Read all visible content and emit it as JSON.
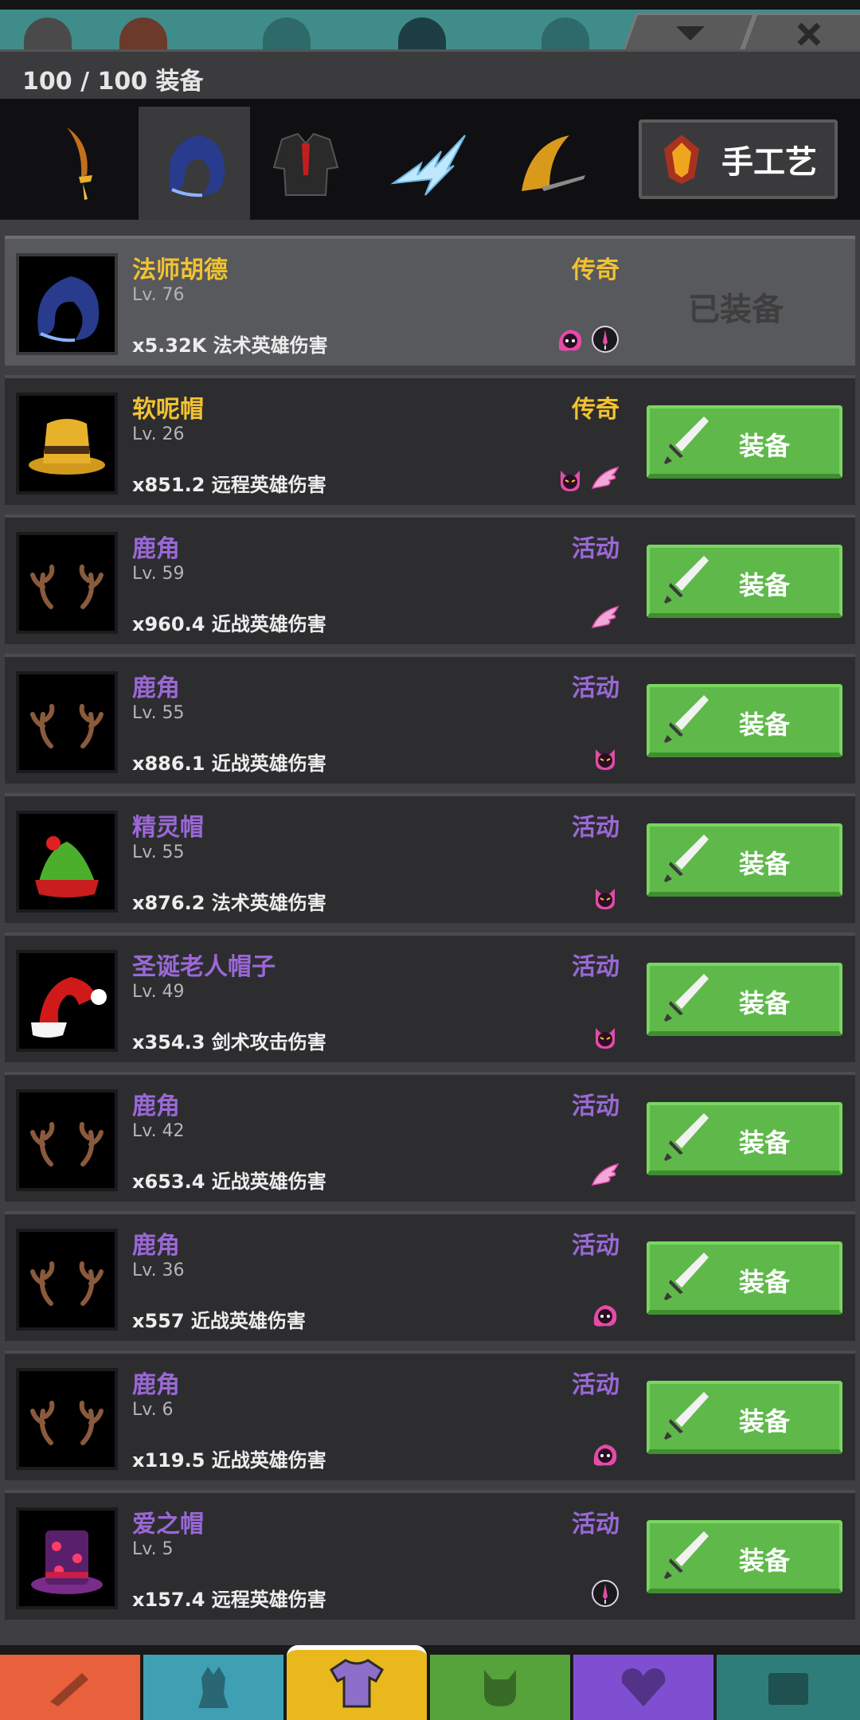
{
  "header": {
    "title": "100 / 100 装备"
  },
  "categories": [
    {
      "name": "weapon"
    },
    {
      "name": "helmet"
    },
    {
      "name": "armor"
    },
    {
      "name": "spell"
    },
    {
      "name": "relic"
    }
  ],
  "craft": {
    "label": "手工艺"
  },
  "colors": {
    "legendary": "#f2c230",
    "event": "#9a68d6",
    "equip_green": "#5fb94a"
  },
  "items": [
    {
      "name": "法师胡德",
      "rarity": "传奇",
      "level": "Lv. 76",
      "damage": "x5.32K 法术英雄伤害",
      "equipped": true,
      "equipped_label": "已装备",
      "icon": "wizard-hood-icon",
      "elements": [
        "shadow-icon",
        "dagger-icon"
      ]
    },
    {
      "name": "软呢帽",
      "rarity": "传奇",
      "level": "Lv. 26",
      "damage": "x851.2 远程英雄伤害",
      "equipped": false,
      "button_label": "装备",
      "icon": "fedora-icon",
      "elements": [
        "demon-icon",
        "wing-icon"
      ]
    },
    {
      "name": "鹿角",
      "rarity": "活动",
      "level": "Lv. 59",
      "damage": "x960.4 近战英雄伤害",
      "equipped": false,
      "button_label": "装备",
      "icon": "antlers-icon",
      "elements": [
        "wing-icon"
      ]
    },
    {
      "name": "鹿角",
      "rarity": "活动",
      "level": "Lv. 55",
      "damage": "x886.1 近战英雄伤害",
      "equipped": false,
      "button_label": "装备",
      "icon": "antlers-icon",
      "elements": [
        "demon-icon"
      ]
    },
    {
      "name": "精灵帽",
      "rarity": "活动",
      "level": "Lv. 55",
      "damage": "x876.2 法术英雄伤害",
      "equipped": false,
      "button_label": "装备",
      "icon": "elf-hat-icon",
      "elements": [
        "demon-icon"
      ]
    },
    {
      "name": "圣诞老人帽子",
      "rarity": "活动",
      "level": "Lv. 49",
      "damage": "x354.3 剑术攻击伤害",
      "equipped": false,
      "button_label": "装备",
      "icon": "santa-hat-icon",
      "elements": [
        "demon-icon"
      ]
    },
    {
      "name": "鹿角",
      "rarity": "活动",
      "level": "Lv. 42",
      "damage": "x653.4 近战英雄伤害",
      "equipped": false,
      "button_label": "装备",
      "icon": "antlers-icon",
      "elements": [
        "wing-icon"
      ]
    },
    {
      "name": "鹿角",
      "rarity": "活动",
      "level": "Lv. 36",
      "damage": "x557 近战英雄伤害",
      "equipped": false,
      "button_label": "装备",
      "icon": "antlers-icon",
      "elements": [
        "shadow-icon"
      ]
    },
    {
      "name": "鹿角",
      "rarity": "活动",
      "level": "Lv. 6",
      "damage": "x119.5 近战英雄伤害",
      "equipped": false,
      "button_label": "装备",
      "icon": "antlers-icon",
      "elements": [
        "shadow-icon"
      ]
    },
    {
      "name": "爱之帽",
      "rarity": "活动",
      "level": "Lv. 5",
      "damage": "x157.4 远程英雄伤害",
      "equipped": false,
      "button_label": "装备",
      "icon": "love-hat-icon",
      "elements": [
        "dagger-icon"
      ]
    }
  ],
  "bottom_nav": [
    {
      "name": "weapons-tab",
      "color": "#e8603c"
    },
    {
      "name": "heroes-tab",
      "color": "#3f9fb3"
    },
    {
      "name": "equipment-tab",
      "color": "#e9b81c"
    },
    {
      "name": "pets-tab",
      "color": "#56a33c"
    },
    {
      "name": "artifacts-tab",
      "color": "#7f4fd1"
    },
    {
      "name": "chest-tab",
      "color": "#2f7d7b"
    }
  ]
}
